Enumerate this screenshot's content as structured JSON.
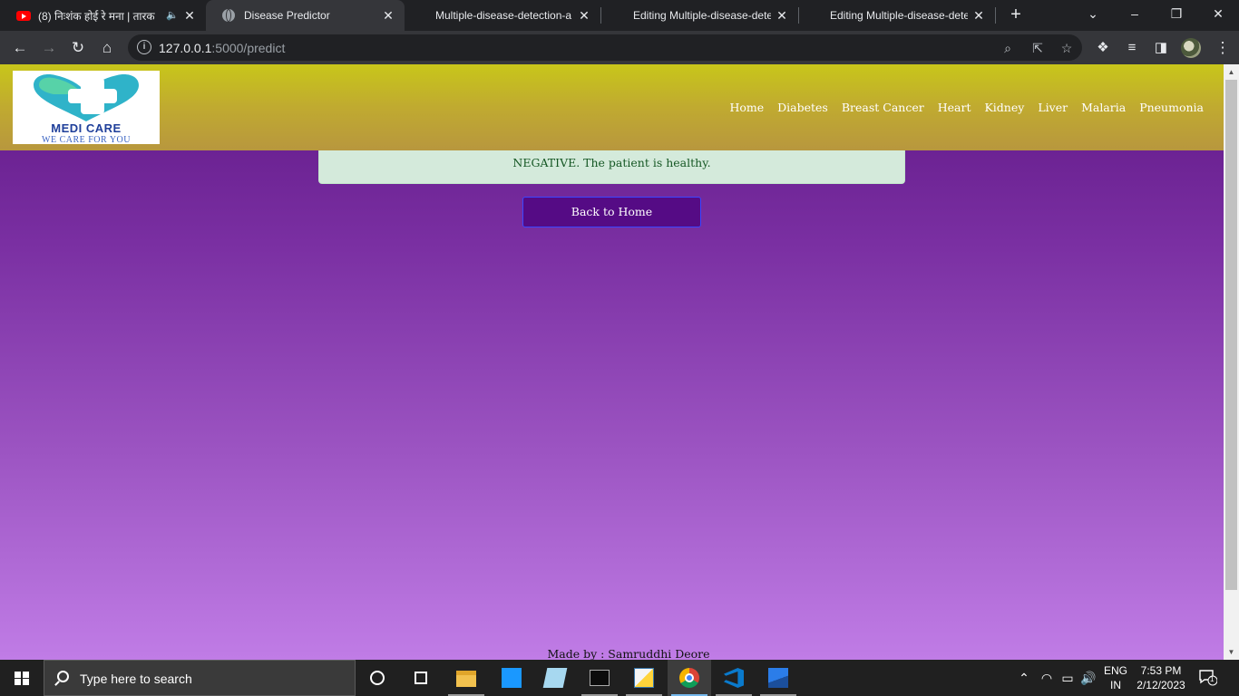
{
  "browser": {
    "tabs": [
      {
        "title": "(8) निःशंक होई रे मना | तारक",
        "icon": "youtube-icon",
        "audio": true,
        "active": false
      },
      {
        "title": "Disease Predictor",
        "icon": "globe-icon",
        "active": true
      },
      {
        "title": "Multiple-disease-detection-a",
        "icon": "",
        "active": false
      },
      {
        "title": "Editing Multiple-disease-dete",
        "icon": "",
        "active": false
      },
      {
        "title": "Editing Multiple-disease-dete",
        "icon": "",
        "active": false
      }
    ],
    "url_host": "127.0.0.1",
    "url_path": ":5000/predict"
  },
  "site": {
    "logo_title": "MEDI CARE",
    "logo_tagline": "WE CARE FOR YOU",
    "nav": [
      "Home",
      "Diabetes",
      "Breast Cancer",
      "Heart",
      "Kidney",
      "Liver",
      "Malaria",
      "Pneumonia"
    ],
    "result_message": "NEGATIVE. The patient is healthy.",
    "back_button": "Back to Home",
    "footer": "Made by : Samruddhi Deore"
  },
  "taskbar": {
    "search_placeholder": "Type here to search",
    "lang_line1": "ENG",
    "lang_line2": "IN",
    "time": "7:53 PM",
    "date": "2/12/2023",
    "notification_count": "1"
  },
  "colors": {
    "header_yellow": "#c8c61a",
    "page_purple_top": "#5f1785",
    "page_purple_bottom": "#c07ce6",
    "alert_green_bg": "#d4eadb",
    "alert_green_text": "#155724",
    "button_purple": "#550b85"
  }
}
